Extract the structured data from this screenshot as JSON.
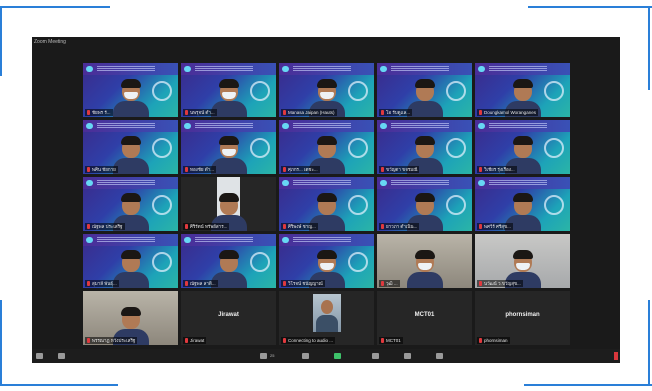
{
  "window": {
    "title": "Zoom Meeting"
  },
  "rows": [
    [
      {
        "kind": "slide",
        "label": "ชัยพร รั...",
        "mask": true
      },
      {
        "kind": "slide",
        "label": "นพรุจน์ ดำ...",
        "mask": true
      },
      {
        "kind": "slide",
        "label": "Manasa Jaipan (Hauts)",
        "mask": true
      },
      {
        "kind": "slide",
        "label": "โอ รับดูแล...",
        "mask": false
      },
      {
        "kind": "slide",
        "label": "Doungkamol Woranganes",
        "mask": false
      }
    ],
    [
      {
        "kind": "slide",
        "label": "พศิน ชัยกาย",
        "mask": false
      },
      {
        "kind": "slide",
        "label": "ทองชัย ดำ...",
        "mask": true
      },
      {
        "kind": "slide",
        "label": "ศุภกร... เตชะ...",
        "mask": false
      },
      {
        "kind": "slide",
        "label": "ขวัญตา ขจรมณี",
        "mask": false
      },
      {
        "kind": "slide",
        "label": "วิเชียร รุ่งเรือง...",
        "mask": false
      }
    ],
    [
      {
        "kind": "slide",
        "label": "ณัฐพล ประเสริฐ",
        "mask": false
      },
      {
        "kind": "phone",
        "label": "ศิริรัตน์ ทรัพย์สาร...",
        "mask": false
      },
      {
        "kind": "slide",
        "label": "ศิริพงษ์ ชาญ...",
        "mask": false
      },
      {
        "kind": "slide",
        "label": "ยาวภา ดำเนิน...",
        "mask": false
      },
      {
        "kind": "slide",
        "label": "พศวีร์ ศรีสุข...",
        "mask": false
      }
    ],
    [
      {
        "kind": "slide",
        "label": "สุมาลี พันธุ์...",
        "mask": false
      },
      {
        "kind": "slide",
        "label": "ณัฐพล ลาดิ...",
        "mask": false
      },
      {
        "kind": "slide",
        "label": "วิโรจน์ ชนัญญาณ์",
        "mask": true
      },
      {
        "kind": "cam",
        "label": "วุฒิ ...",
        "mask": true
      },
      {
        "kind": "room",
        "label": "นวัฒน์ ว.ขวัญสุข...",
        "mask": true
      }
    ],
    [
      {
        "kind": "cam",
        "label": "พรรณาฏ หวังประเสริฐ",
        "mask": false
      },
      {
        "kind": "name",
        "name": "Jirawat",
        "label": "Jirawat"
      },
      {
        "kind": "portrait",
        "label": "Connecting to audio ..."
      },
      {
        "kind": "name",
        "name": "MCT01",
        "label": "MCT01"
      },
      {
        "kind": "name",
        "name": "phornsiman",
        "label": "phornsiman"
      }
    ]
  ],
  "toolbar": {
    "participants_count": "25"
  },
  "colors": {
    "accent": "#2a7fd8",
    "meeting_bg": "#1a1a1a",
    "mic_muted": "#e0393e"
  }
}
